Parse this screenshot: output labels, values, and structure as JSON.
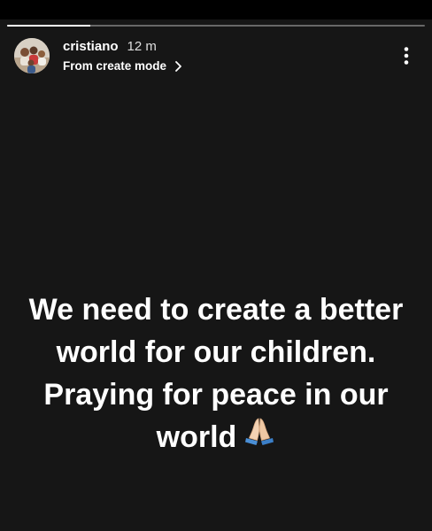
{
  "story": {
    "progress": 0.2,
    "author": {
      "username": "cristiano",
      "time": "12 m",
      "subtitle": "From create mode"
    },
    "caption_lines": [
      "We need to create a better",
      "world for our children.",
      "Praying for peace in our",
      "world"
    ],
    "emoji": "praying-hands-icon",
    "more_icon": "more-vertical-icon",
    "chevron_icon": "chevron-right-icon"
  },
  "colors": {
    "background": "#161616",
    "text": "#ffffff"
  }
}
